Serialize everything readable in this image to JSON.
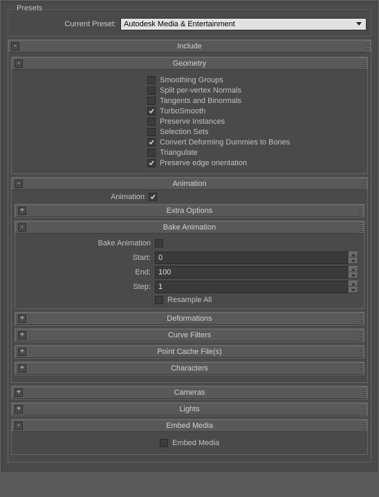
{
  "presets": {
    "fieldset_label": "Presets",
    "label": "Current Preset:",
    "value": "Autodesk Media & Entertainment"
  },
  "include": {
    "title": "Include",
    "geometry": {
      "title": "Geometry",
      "items": [
        {
          "label": "Smoothing Groups",
          "checked": false
        },
        {
          "label": "Split per-vertex Normals",
          "checked": false
        },
        {
          "label": "Tangents and Binormals",
          "checked": false
        },
        {
          "label": "TurboSmooth",
          "checked": true
        },
        {
          "label": "Preserve Instances",
          "checked": false
        },
        {
          "label": "Selection Sets",
          "checked": false
        },
        {
          "label": "Convert Deforming Dummies to Bones",
          "checked": true
        },
        {
          "label": "Triangulate",
          "checked": false
        },
        {
          "label": "Preserve edge orientation",
          "checked": true
        }
      ]
    },
    "animation": {
      "title": "Animation",
      "animation_label": "Animation",
      "animation_checked": true,
      "extra_options": {
        "title": "Extra Options"
      },
      "bake": {
        "title": "Bake Animation",
        "bake_label": "Bake Animation",
        "bake_checked": false,
        "start_label": "Start:",
        "start_value": "0",
        "end_label": "End:",
        "end_value": "100",
        "step_label": "Step:",
        "step_value": "1",
        "resample_label": "Resample All",
        "resample_checked": false
      },
      "deformations": {
        "title": "Deformations"
      },
      "curve_filters": {
        "title": "Curve Filters"
      },
      "point_cache": {
        "title": "Point Cache File(s)"
      },
      "characters": {
        "title": "Characters"
      }
    },
    "cameras": {
      "title": "Cameras"
    },
    "lights": {
      "title": "Lights"
    },
    "embed": {
      "title": "Embed Media",
      "label": "Embed Media",
      "checked": false
    }
  },
  "toggles": {
    "minus": "-",
    "plus": "+"
  }
}
